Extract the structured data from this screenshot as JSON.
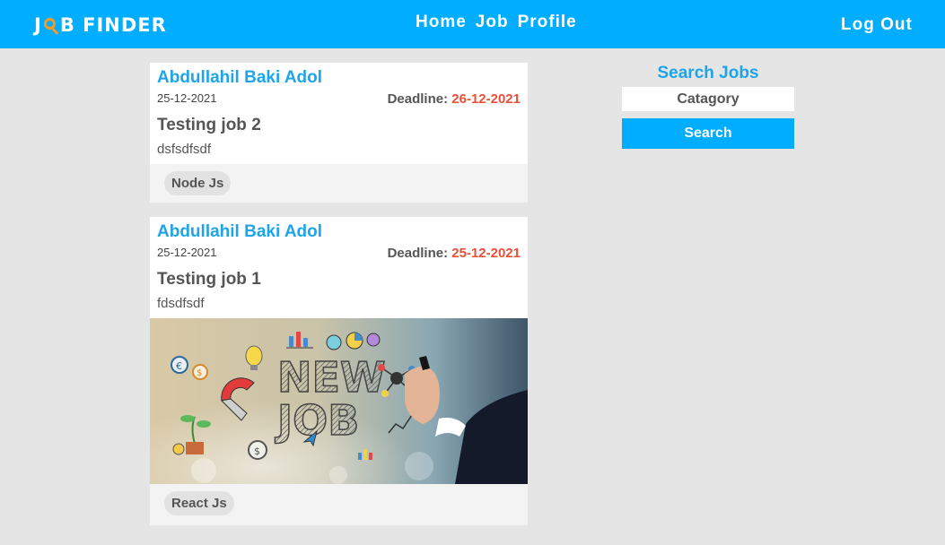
{
  "navbar": {
    "logo_left": "J",
    "logo_right": "B FINDER",
    "links": [
      "Home",
      "Job",
      "Profile"
    ],
    "logout": "Log Out"
  },
  "jobs": [
    {
      "poster": "Abdullahil Baki Adol",
      "posted_date": "25-12-2021",
      "deadline_label": "Deadline: ",
      "deadline": "26-12-2021",
      "title": "Testing job 2",
      "description": "dsfsdfsdf",
      "tag": "Node Js"
    },
    {
      "poster": "Abdullahil Baki Adol",
      "posted_date": "25-12-2021",
      "deadline_label": "Deadline: ",
      "deadline": "25-12-2021",
      "title": "Testing job 1",
      "description": "fdsdfsdf",
      "tag": "React Js",
      "image_text": [
        "NEW",
        "JOB"
      ]
    }
  ],
  "sidebar": {
    "title": "Search Jobs",
    "category_placeholder": "Catagory",
    "search_label": "Search"
  },
  "colors": {
    "primary": "#00adff",
    "link": "#1ea4e9",
    "deadline": "#e8503a",
    "logo_accent": "#f59a23"
  },
  "icons": [
    "magnifier-logo-icon"
  ]
}
